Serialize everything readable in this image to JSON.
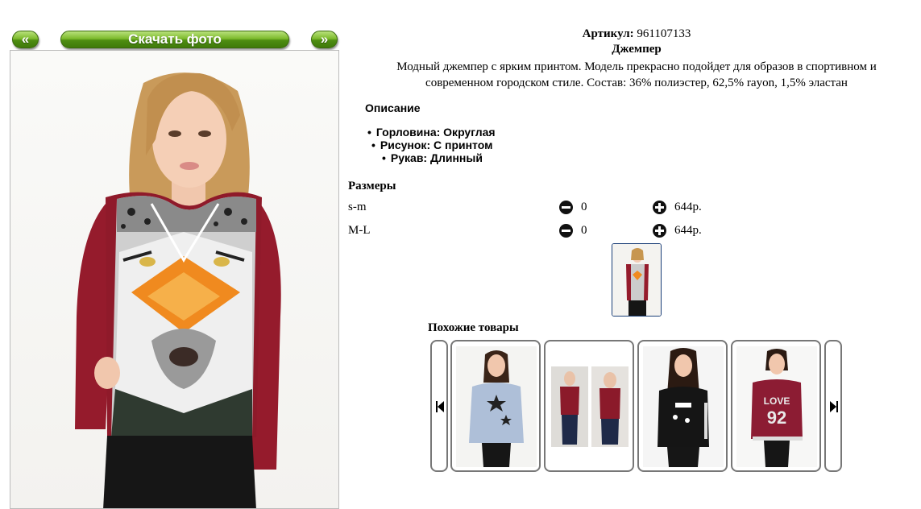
{
  "photo_panel": {
    "prev_label": "«",
    "download_label": "Скачать фото",
    "next_label": "»"
  },
  "product": {
    "sku_label": "Артикул:",
    "sku_value": "961107133",
    "name": "Джемпер",
    "description": "Модный джемпер с ярким принтом. Модель прекрасно подойдет для образов в спортивном и современном городском стиле. Состав: 36% полиэстер, 62,5% rayon, 1,5% эластан"
  },
  "details": {
    "heading": "Описание",
    "features": [
      "Горловина: Округлая",
      "Рисунок: С принтом",
      "Рукав: Длинный"
    ]
  },
  "sizes": {
    "heading": "Размеры",
    "rows": [
      {
        "name": "s-m",
        "qty": "0",
        "price": "644р."
      },
      {
        "name": "M-L",
        "qty": "0",
        "price": "644р."
      }
    ]
  },
  "similar": {
    "heading": "Похожие товары"
  },
  "colors": {
    "button_green": "#5a9e1b",
    "sweater_burgundy": "#9b1b2b",
    "border_gray": "#777777",
    "thumb_border": "#1b3f78"
  },
  "icons": [
    "minus-circle-icon",
    "plus-circle-icon",
    "skip-prev-icon",
    "skip-next-icon"
  ]
}
